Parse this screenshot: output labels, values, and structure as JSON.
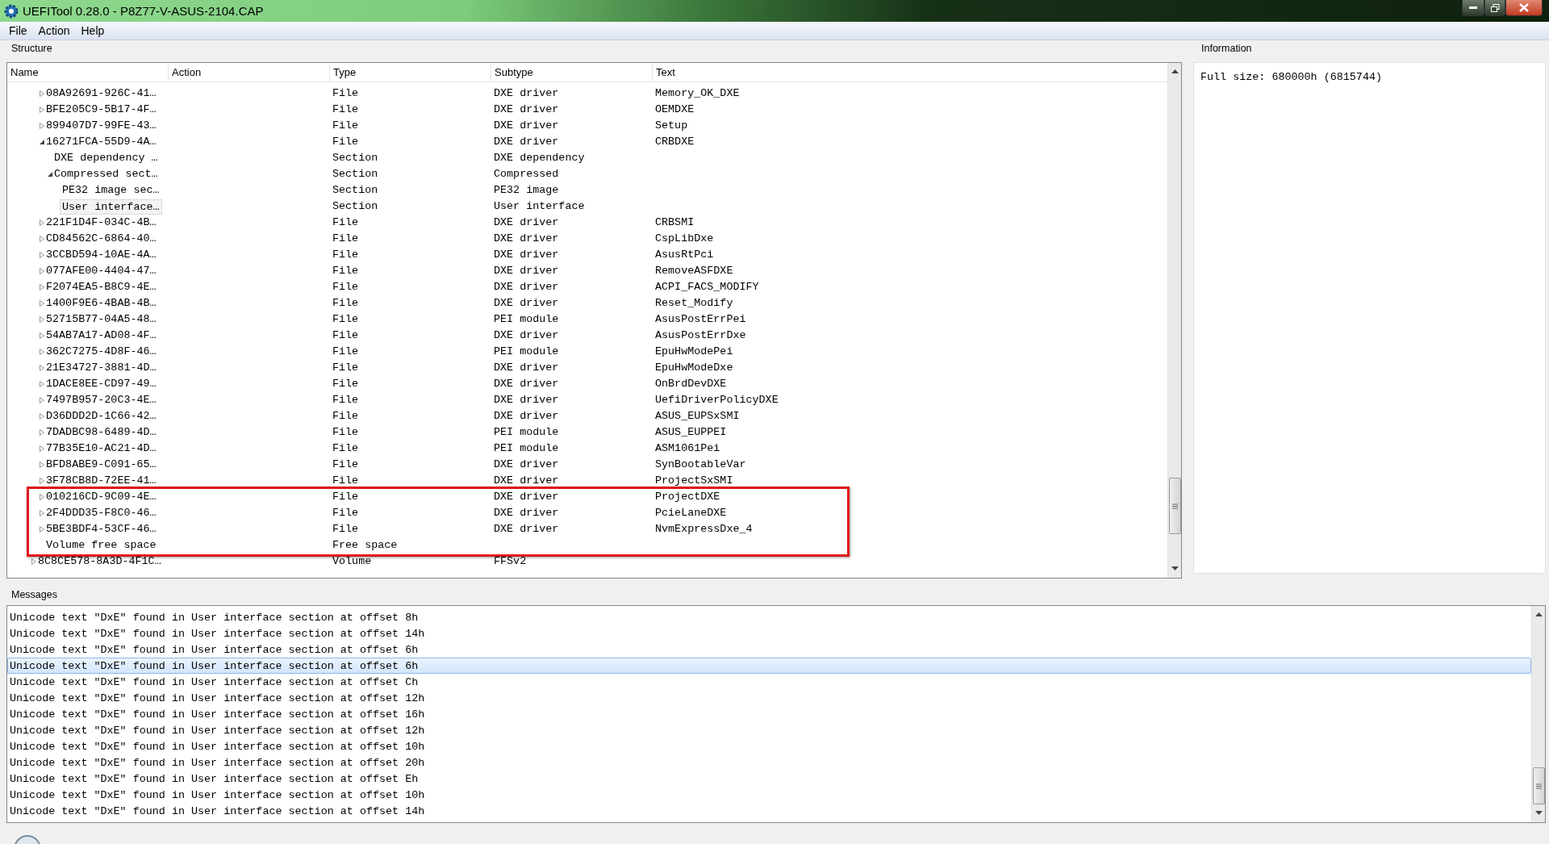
{
  "window": {
    "title": "UEFITool 0.28.0 - P8Z77-V-ASUS-2104.CAP"
  },
  "menu": [
    {
      "label": "File"
    },
    {
      "label": "Action"
    },
    {
      "label": "Help"
    }
  ],
  "structure": {
    "title": "Structure",
    "columns": [
      "Name",
      "Action",
      "Type",
      "Subtype",
      "Text"
    ],
    "rows": [
      {
        "name": "08A92691-926C-41…",
        "type": "File",
        "subtype": "DXE driver",
        "text": "Memory_OK_DXE",
        "expanded": false,
        "selected": false,
        "annotated": false
      },
      {
        "name": "BFE205C9-5B17-4F…",
        "type": "File",
        "subtype": "DXE driver",
        "text": "OEMDXE",
        "expanded": false,
        "selected": false,
        "annotated": false
      },
      {
        "name": "899407D7-99FE-43…",
        "type": "File",
        "subtype": "DXE driver",
        "text": "Setup",
        "expanded": false,
        "selected": false,
        "annotated": false
      },
      {
        "name": "16271FCA-55D9-4A…",
        "type": "File",
        "subtype": "DXE driver",
        "text": "CRBDXE",
        "expanded": true,
        "selected": false,
        "annotated": false,
        "children": [
          {
            "name": "DXE dependency …",
            "type": "Section",
            "subtype": "DXE dependency",
            "selected": false,
            "annotated": false
          },
          {
            "name": "Compressed sect…",
            "type": "Section",
            "subtype": "Compressed",
            "expanded": true,
            "selected": false,
            "annotated": false,
            "children": [
              {
                "name": "PE32 image sec…",
                "type": "Section",
                "subtype": "PE32 image",
                "selected": false,
                "annotated": false
              },
              {
                "name": "User interface…",
                "type": "Section",
                "subtype": "User interface",
                "selected": true,
                "annotated": false
              }
            ]
          }
        ]
      },
      {
        "name": "221F1D4F-034C-4B…",
        "type": "File",
        "subtype": "DXE driver",
        "text": "CRBSMI",
        "expanded": false,
        "selected": false,
        "annotated": false
      },
      {
        "name": "CD84562C-6864-40…",
        "type": "File",
        "subtype": "DXE driver",
        "text": "CspLibDxe",
        "expanded": false,
        "selected": false,
        "annotated": false
      },
      {
        "name": "3CCBD594-10AE-4A…",
        "type": "File",
        "subtype": "DXE driver",
        "text": "AsusRtPci",
        "expanded": false,
        "selected": false,
        "annotated": false
      },
      {
        "name": "077AFE00-4404-47…",
        "type": "File",
        "subtype": "DXE driver",
        "text": "RemoveASFDXE",
        "expanded": false,
        "selected": false,
        "annotated": false
      },
      {
        "name": "F2074EA5-B8C9-4E…",
        "type": "File",
        "subtype": "DXE driver",
        "text": "ACPI_FACS_MODIFY",
        "expanded": false,
        "selected": false,
        "annotated": false
      },
      {
        "name": "1400F9E6-4BAB-4B…",
        "type": "File",
        "subtype": "DXE driver",
        "text": "Reset_Modify",
        "expanded": false,
        "selected": false,
        "annotated": false
      },
      {
        "name": "52715B77-04A5-48…",
        "type": "File",
        "subtype": "PEI module",
        "text": "AsusPostErrPei",
        "expanded": false,
        "selected": false,
        "annotated": false
      },
      {
        "name": "54AB7A17-AD08-4F…",
        "type": "File",
        "subtype": "DXE driver",
        "text": "AsusPostErrDxe",
        "expanded": false,
        "selected": false,
        "annotated": false
      },
      {
        "name": "362C7275-4D8F-46…",
        "type": "File",
        "subtype": "PEI module",
        "text": "EpuHwModePei",
        "expanded": false,
        "selected": false,
        "annotated": false
      },
      {
        "name": "21E34727-3881-4D…",
        "type": "File",
        "subtype": "DXE driver",
        "text": "EpuHwModeDxe",
        "expanded": false,
        "selected": false,
        "annotated": false
      },
      {
        "name": "1DACE8EE-CD97-49…",
        "type": "File",
        "subtype": "DXE driver",
        "text": "OnBrdDevDXE",
        "expanded": false,
        "selected": false,
        "annotated": false
      },
      {
        "name": "7497B957-20C3-4E…",
        "type": "File",
        "subtype": "DXE driver",
        "text": "UefiDriverPolicyDXE",
        "expanded": false,
        "selected": false,
        "annotated": false
      },
      {
        "name": "D36DDD2D-1C66-42…",
        "type": "File",
        "subtype": "DXE driver",
        "text": "ASUS_EUPSxSMI",
        "expanded": false,
        "selected": false,
        "annotated": false
      },
      {
        "name": "7DADBC98-6489-4D…",
        "type": "File",
        "subtype": "PEI module",
        "text": "ASUS_EUPPEI",
        "expanded": false,
        "selected": false,
        "annotated": false
      },
      {
        "name": "77B35E10-AC21-4D…",
        "type": "File",
        "subtype": "PEI module",
        "text": "ASM1061Pei",
        "expanded": false,
        "selected": false,
        "annotated": false
      },
      {
        "name": "BFD8ABE9-C091-65…",
        "type": "File",
        "subtype": "DXE driver",
        "text": "SynBootableVar",
        "expanded": false,
        "selected": false,
        "annotated": false
      },
      {
        "name": "3F78CB8D-72EE-41…",
        "type": "File",
        "subtype": "DXE driver",
        "text": "ProjectSxSMI",
        "expanded": false,
        "selected": false,
        "annotated": false
      },
      {
        "name": "010216CD-9C09-4E…",
        "type": "File",
        "subtype": "DXE driver",
        "text": "ProjectDXE",
        "expanded": false,
        "selected": false,
        "annotated": true
      },
      {
        "name": "2F4DDD35-F8C0-46…",
        "type": "File",
        "subtype": "DXE driver",
        "text": "PcieLaneDXE",
        "expanded": false,
        "selected": false,
        "annotated": true
      },
      {
        "name": "5BE3BDF4-53CF-46…",
        "type": "File",
        "subtype": "DXE driver",
        "text": "NvmExpressDxe_4",
        "expanded": false,
        "selected": false,
        "annotated": true
      },
      {
        "name": "Volume free space",
        "type": "Free space",
        "selected": false,
        "annotated": true
      }
    ],
    "outer_rows": [
      {
        "name": "8C8CE578-8A3D-4F1C…",
        "type": "Volume",
        "subtype": "FFSv2",
        "expanded": false,
        "selected": false,
        "annotated": false
      }
    ]
  },
  "information": {
    "title": "Information",
    "text": "Full size: 680000h (6815744)"
  },
  "messages": {
    "title": "Messages",
    "items": [
      {
        "text": "Unicode text \"DxE\" found in User interface section at offset 8h",
        "selected": false
      },
      {
        "text": "Unicode text \"DxE\" found in User interface section at offset 14h",
        "selected": false
      },
      {
        "text": "Unicode text \"DxE\" found in User interface section at offset 6h",
        "selected": false
      },
      {
        "text": "Unicode text \"DxE\" found in User interface section at offset 6h",
        "selected": true
      },
      {
        "text": "Unicode text \"DxE\" found in User interface section at offset Ch",
        "selected": false
      },
      {
        "text": "Unicode text \"DxE\" found in User interface section at offset 12h",
        "selected": false
      },
      {
        "text": "Unicode text \"DxE\" found in User interface section at offset 16h",
        "selected": false
      },
      {
        "text": "Unicode text \"DxE\" found in User interface section at offset 12h",
        "selected": false
      },
      {
        "text": "Unicode text \"DxE\" found in User interface section at offset 10h",
        "selected": false
      },
      {
        "text": "Unicode text \"DxE\" found in User interface section at offset 20h",
        "selected": false
      },
      {
        "text": "Unicode text \"DxE\" found in User interface section at offset Eh",
        "selected": false
      },
      {
        "text": "Unicode text \"DxE\" found in User interface section at offset 10h",
        "selected": false
      },
      {
        "text": "Unicode text \"DxE\" found in User interface section at offset 14h",
        "selected": false
      }
    ]
  }
}
